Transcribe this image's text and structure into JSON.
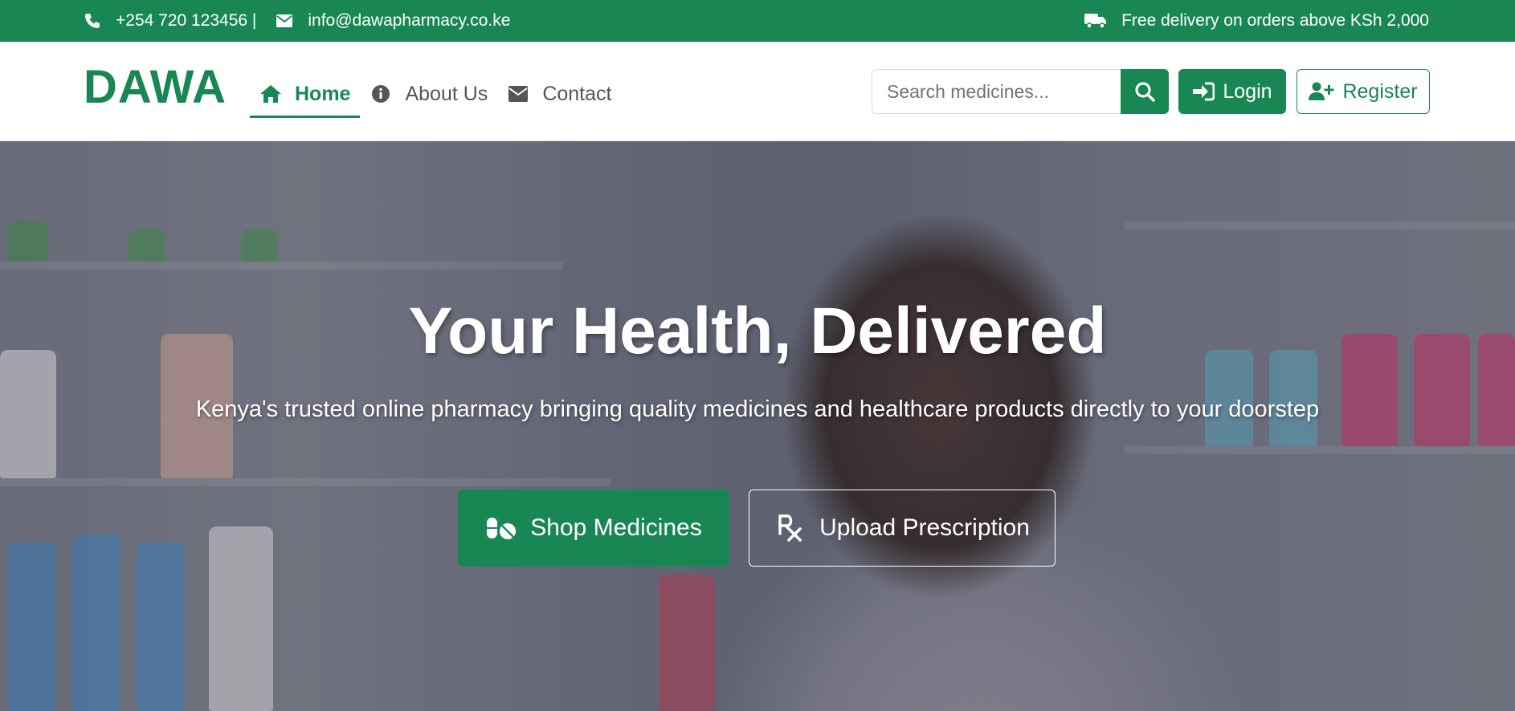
{
  "topbar": {
    "phone": "+254 720 123456 |",
    "email": "info@dawapharmacy.co.ke",
    "delivery": "Free delivery on orders above KSh 2,000",
    "icons": [
      "phone-icon",
      "envelope-icon",
      "truck-icon"
    ]
  },
  "navbar": {
    "brand": "DAWA",
    "items": [
      {
        "label": "Home",
        "icon": "home-icon",
        "active": true
      },
      {
        "label": "About Us",
        "icon": "info-icon",
        "active": false
      },
      {
        "label": "Contact",
        "icon": "envelope-icon",
        "active": false
      }
    ],
    "search": {
      "placeholder": "Search medicines...",
      "value": ""
    },
    "login_label": "Login",
    "register_label": "Register"
  },
  "hero": {
    "title": "Your Health, Delivered",
    "subtitle": "Kenya's trusted online pharmacy bringing quality medicines and healthcare products directly to your doorstep",
    "shop_label": "Shop Medicines",
    "upload_label": "Upload Prescription"
  },
  "colors": {
    "brand": "#198754",
    "white": "#ffffff",
    "text": "#555555"
  }
}
